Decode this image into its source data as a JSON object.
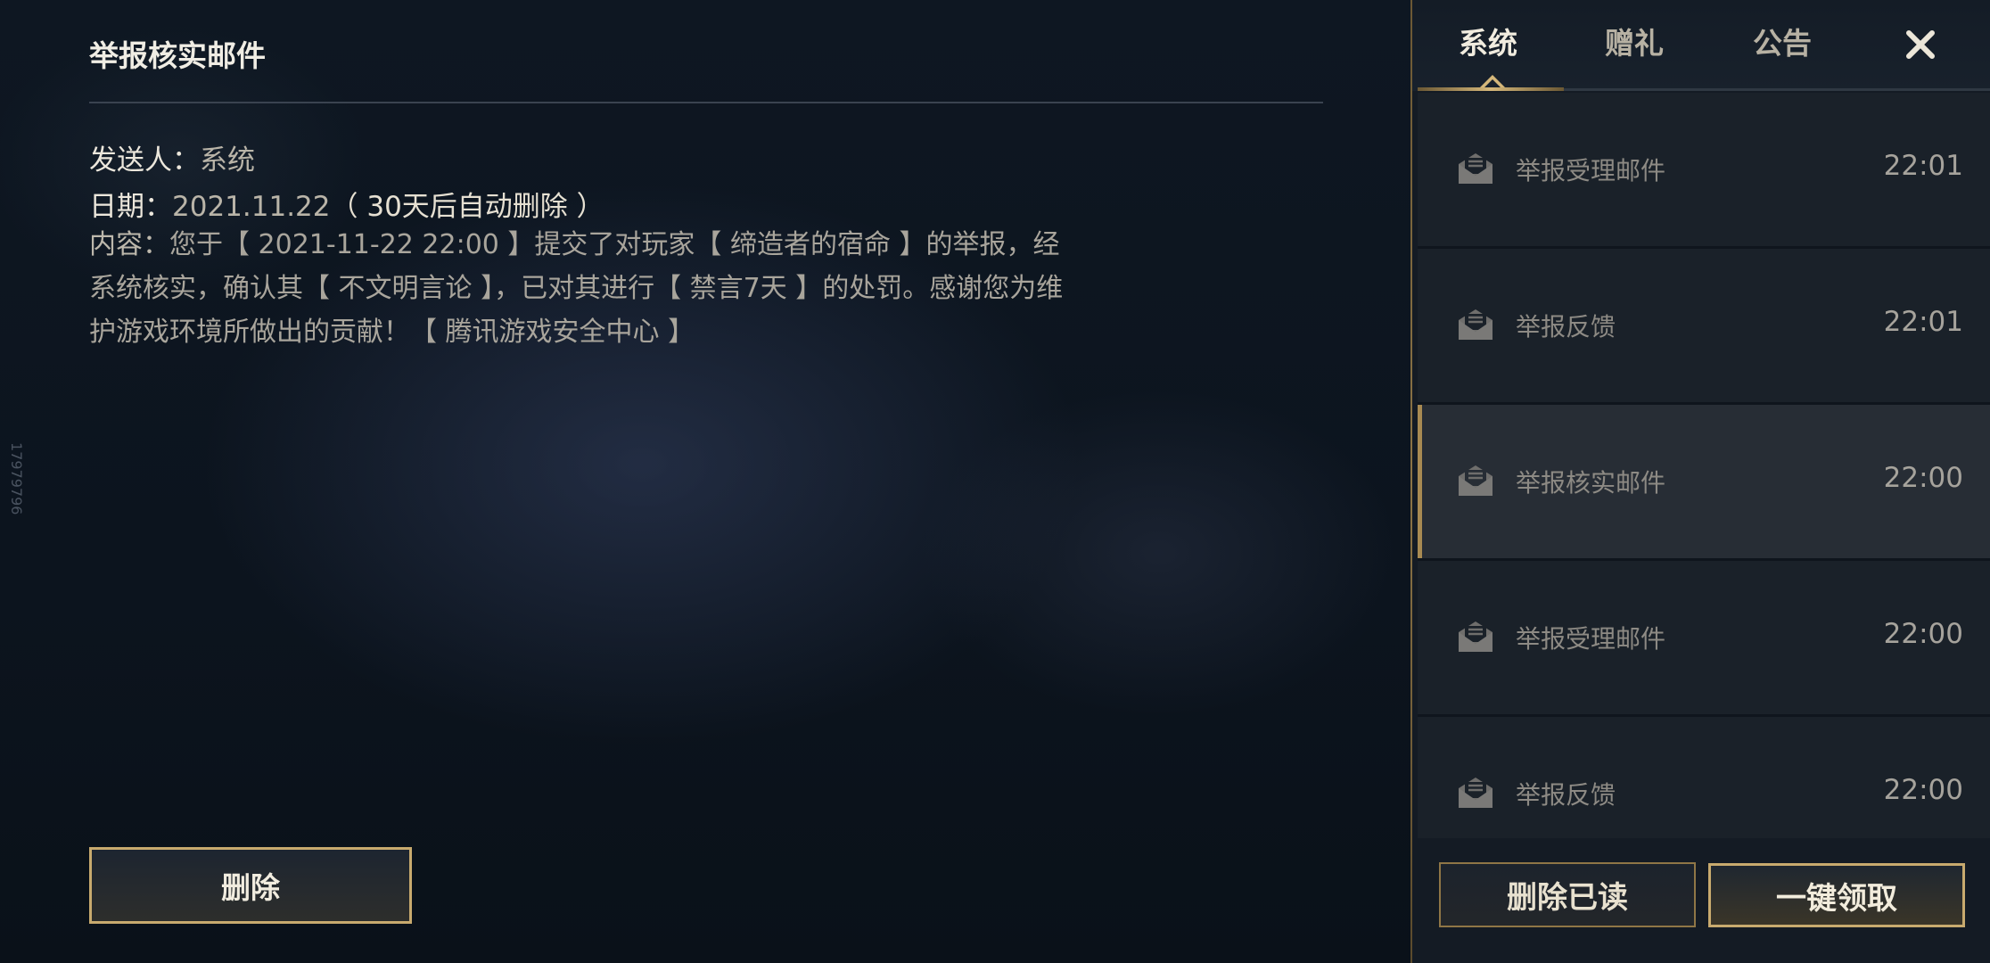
{
  "detail": {
    "title": "举报核实邮件",
    "sender_label": "发送人：",
    "sender": "系统",
    "date_label": "日期：",
    "date": "2021.11.22",
    "auto_delete": "（ 30天后自动删除 ）",
    "content_label": "内容：",
    "content": "您于【 2021-11-22 22:00 】提交了对玩家【 缔造者的宿命 】的举报，经系统核实，确认其【 不文明言论 】，已对其进行【 禁言7天 】的处罚。感谢您为维护游戏环境所做出的贡献！【 腾讯游戏安全中心 】",
    "delete_label": "删除"
  },
  "side_code": "17979796",
  "tabs": [
    {
      "label": "系统",
      "active": true
    },
    {
      "label": "赠礼",
      "active": false
    },
    {
      "label": "公告",
      "active": false
    }
  ],
  "close_icon": "close-icon",
  "mails": [
    {
      "subject": "举报受理邮件",
      "time": "22:01",
      "selected": false,
      "icon": "mail-open-icon"
    },
    {
      "subject": "举报反馈",
      "time": "22:01",
      "selected": false,
      "icon": "mail-open-icon"
    },
    {
      "subject": "举报核实邮件",
      "time": "22:00",
      "selected": true,
      "icon": "mail-open-icon"
    },
    {
      "subject": "举报受理邮件",
      "time": "22:00",
      "selected": false,
      "icon": "mail-open-icon"
    },
    {
      "subject": "举报反馈",
      "time": "22:00",
      "selected": false,
      "icon": "mail-open-icon"
    }
  ],
  "buttons": {
    "delete_read": "删除已读",
    "claim_all": "一键领取"
  },
  "colors": {
    "gold": "#c8aa6e",
    "panel": "#141b24",
    "selected_row": "#272d35"
  }
}
